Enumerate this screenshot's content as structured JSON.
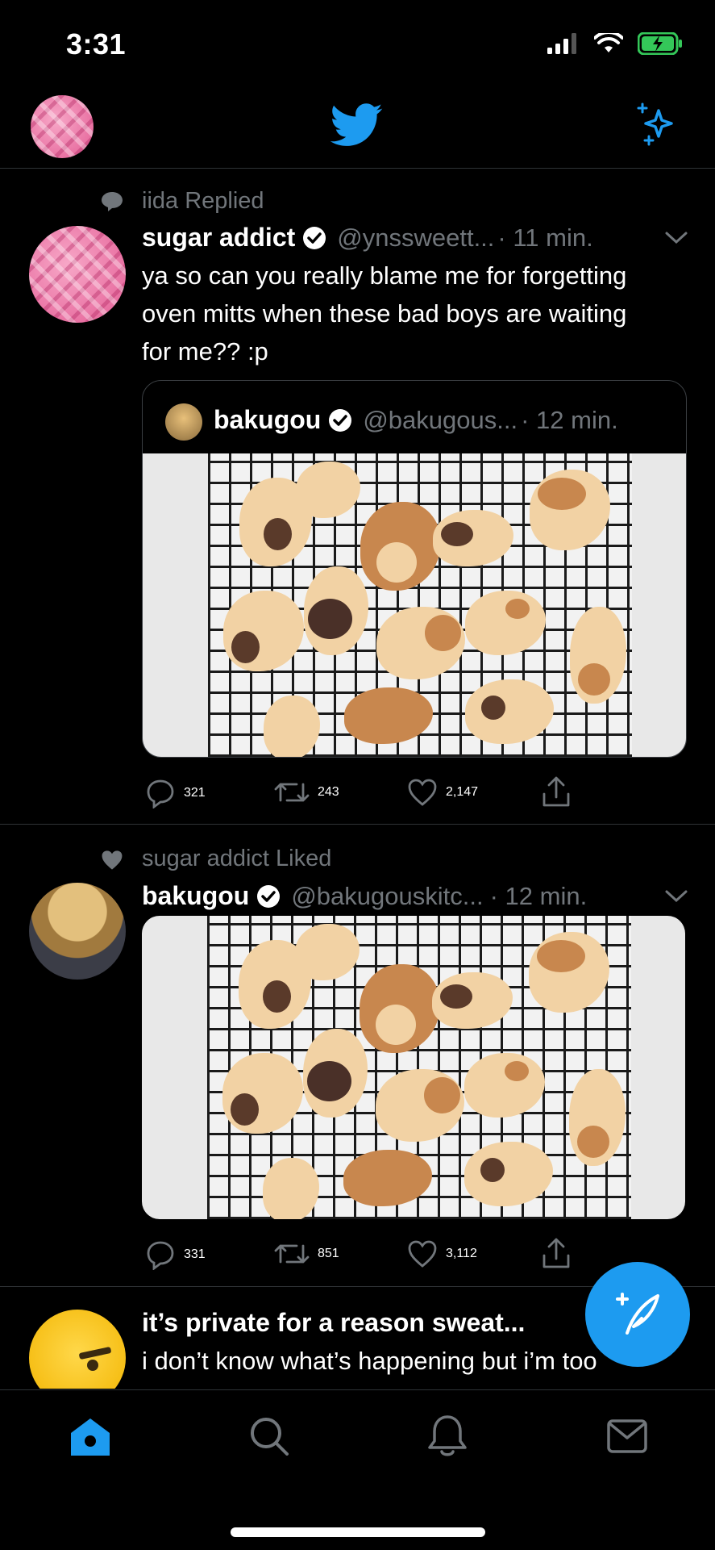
{
  "status_bar": {
    "time": "3:31"
  },
  "header": {
    "logo": "twitter-bird-icon",
    "sparkle": "sparkle-icon"
  },
  "tweets": [
    {
      "context": "iida Replied",
      "name": "sugar addict",
      "handle": "@ynssweett...",
      "time": "· 11 min.",
      "text": "ya so can you really blame me for forgetting oven mitts when these bad boys are waiting for me?? :p",
      "quote": {
        "name": "bakugou",
        "handle": "@bakugous...",
        "time": "· 12 min."
      },
      "replies": "321",
      "retweets": "243",
      "likes": "2,147"
    },
    {
      "context": "sugar addict Liked",
      "name": "bakugou",
      "handle": "@bakugouskitc...",
      "time": "· 12 min.",
      "replies": "331",
      "retweets": "851",
      "likes": "3,112"
    },
    {
      "name": "it’s private for a reason sweat...",
      "text": "i don’t know what’s happening but i’m too"
    }
  ],
  "tabbar": {
    "items": [
      "home-icon",
      "search-icon",
      "notifications-icon",
      "messages-icon"
    ]
  },
  "colors": {
    "accent": "#1d9bf0",
    "muted": "#71767b",
    "divider": "#2f3336"
  }
}
